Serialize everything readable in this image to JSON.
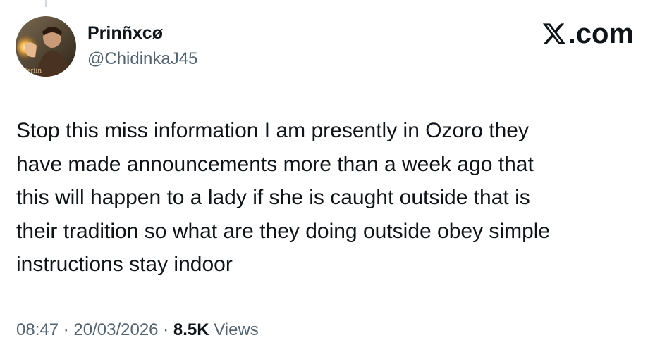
{
  "author": {
    "display_name": "Prinñxcø",
    "handle": "@ChidinkaJ45",
    "avatar_caption": "Merlin"
  },
  "brand": {
    "text": ".com",
    "icon": "x-logo-icon"
  },
  "tweet": {
    "lines": [
      "Stop this miss information I am presently in Ozoro they",
      "have made announcements more than a week ago that",
      "this will happen to a lady if she is caught outside that is",
      "their tradition so what are they doing outside obey simple",
      "instructions stay indoor"
    ]
  },
  "meta": {
    "time": "08:47",
    "separator": " · ",
    "date": "20/03/2026",
    "views_count": "8.5K",
    "views_label": " Views"
  },
  "colors": {
    "text_primary": "#0f1419",
    "text_secondary": "#536471",
    "background": "#ffffff"
  }
}
